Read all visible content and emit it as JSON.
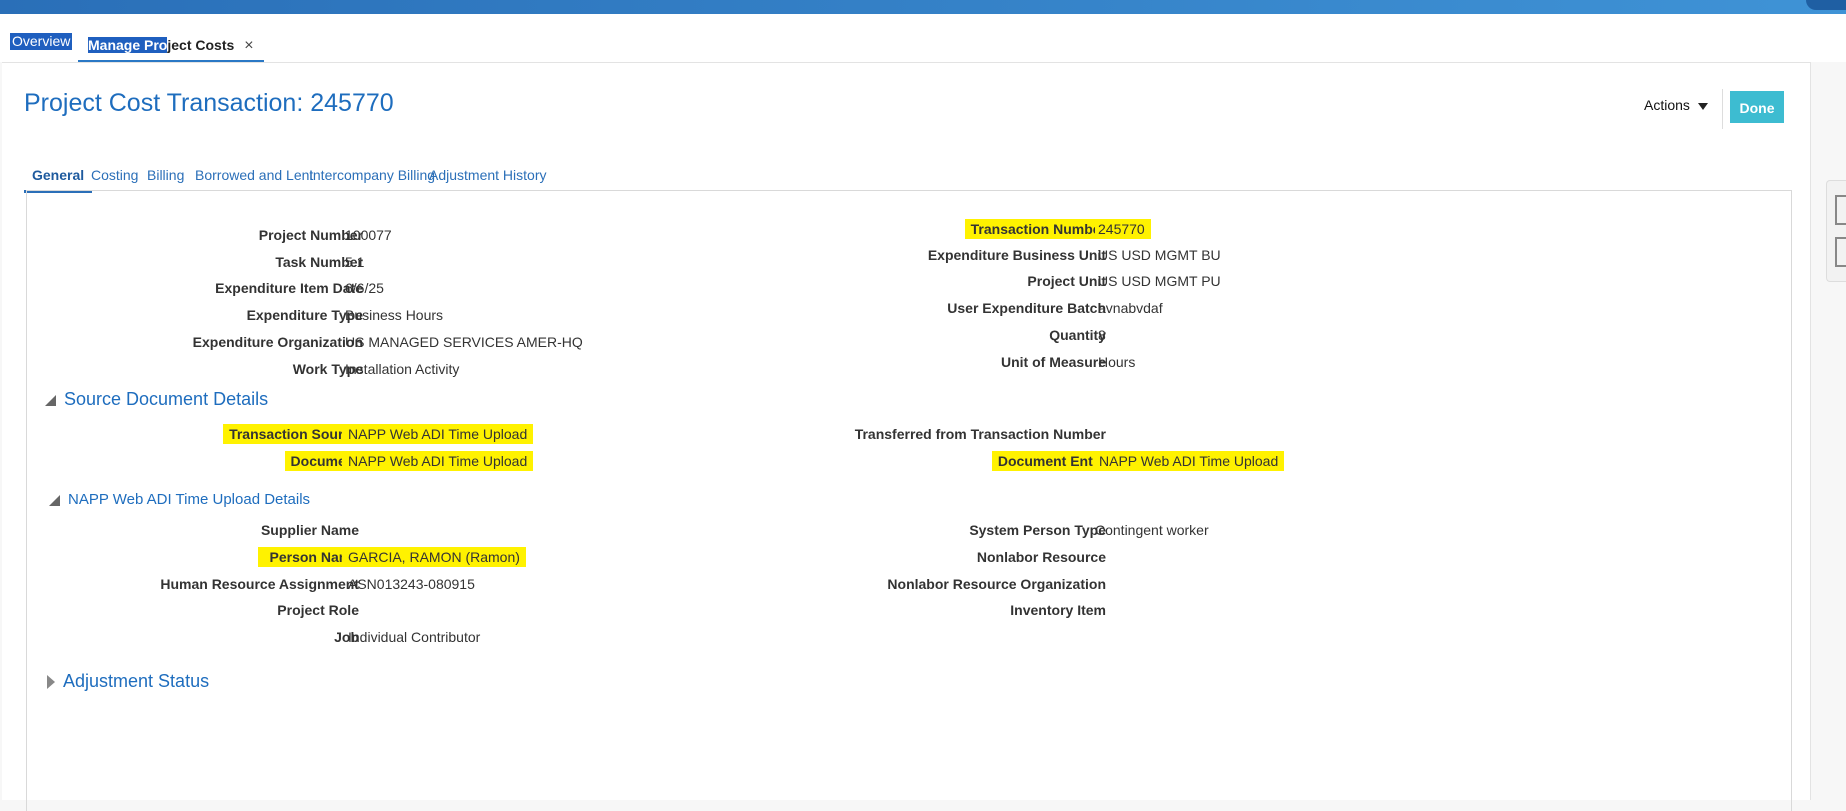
{
  "page_tabs": [
    {
      "label": "Overview"
    },
    {
      "label_highlighted": "Manage Pro",
      "label_rest": "ject Costs",
      "close_icon": "×"
    }
  ],
  "page": {
    "title": "Project Cost Transaction: 245770",
    "actions_label": "Actions",
    "done_label": "Done"
  },
  "sub_tabs": [
    "General",
    "Costing",
    "Billing",
    "Borrowed and Lent",
    "Intercompany Billing",
    "Adjustment History"
  ],
  "general": {
    "left": [
      {
        "label": "Project Number",
        "value": "100077"
      },
      {
        "label": "Task Number",
        "value": "5.1"
      },
      {
        "label": "Expenditure Item Date",
        "value": "6/6/25"
      },
      {
        "label": "Expenditure Type",
        "value": "Business Hours"
      },
      {
        "label": "Expenditure Organization",
        "value": "US MANAGED SERVICES AMER-HQ"
      },
      {
        "label": "Work Type",
        "value": "Installation Activity"
      }
    ],
    "right": [
      {
        "label": "Transaction Number",
        "value": "245770"
      },
      {
        "label": "Expenditure Business Unit",
        "value": "US USD MGMT BU"
      },
      {
        "label": "Project Unit",
        "value": "US USD MGMT PU"
      },
      {
        "label": "User Expenditure Batch",
        "value": "avnabvdaf"
      },
      {
        "label": "Quantity",
        "value": "8"
      },
      {
        "label": "Unit of Measure",
        "value": "Hours"
      }
    ]
  },
  "source_section": {
    "title": "Source Document Details",
    "left": [
      {
        "label": "Transaction Source",
        "value": "NAPP Web ADI Time Upload"
      },
      {
        "label": "Document",
        "value": "NAPP Web ADI Time Upload"
      }
    ],
    "right": [
      {
        "label": "Transferred from Transaction Number",
        "value": ""
      },
      {
        "label": "Document Entry",
        "value": "NAPP Web ADI Time Upload"
      }
    ]
  },
  "napp_section": {
    "title": "NAPP Web ADI Time Upload Details",
    "left": [
      {
        "label": "Supplier Name",
        "value": ""
      },
      {
        "label": "Person Name",
        "value": "GARCIA, RAMON (Ramon)"
      },
      {
        "label": "Human Resource Assignment",
        "value": "ASN013243-080915"
      },
      {
        "label": "Project Role",
        "value": ""
      },
      {
        "label": "Job",
        "value": "Individual Contributor"
      }
    ],
    "right": [
      {
        "label": "System Person Type",
        "value": "Contingent worker"
      },
      {
        "label": "Nonlabor Resource",
        "value": ""
      },
      {
        "label": "Nonlabor Resource Organization",
        "value": ""
      },
      {
        "label": "Inventory Item",
        "value": ""
      }
    ]
  },
  "adjustment_section": {
    "title": "Adjustment Status"
  },
  "colors": {
    "accent": "#1e6dbe",
    "done_button": "#3dbcd1",
    "highlight": "#fff200"
  }
}
